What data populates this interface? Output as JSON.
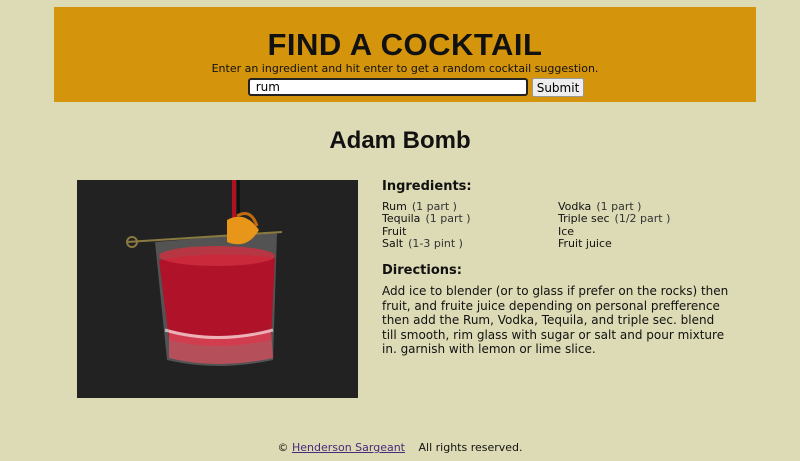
{
  "header": {
    "title": "FIND A COCKTAIL",
    "subtitle": "Enter an ingredient and hit enter to get a random cocktail suggestion.",
    "search_value": "rum",
    "submit_label": "Submit"
  },
  "cocktail": {
    "name": "Adam Bomb",
    "ingredients_title": "Ingredients:",
    "ingredients": [
      {
        "name": "Rum",
        "measure": "(1 part )"
      },
      {
        "name": "Vodka",
        "measure": "(1 part )"
      },
      {
        "name": "Tequila",
        "measure": "(1 part )"
      },
      {
        "name": "Triple sec",
        "measure": "(1/2 part )"
      },
      {
        "name": "Fruit",
        "measure": ""
      },
      {
        "name": "Ice",
        "measure": ""
      },
      {
        "name": "Salt",
        "measure": "(1-3 pint )"
      },
      {
        "name": "Fruit juice",
        "measure": ""
      }
    ],
    "directions_title": "Directions:",
    "directions": "Add ice to blender (or to glass if prefer on the rocks) then fruit, and fruite juice depending on personal prefference then add the Rum, Vodka, Tequila, and triple sec. blend till smooth, rim glass with sugar or salt and pour mixture in. garnish with lemon or lime slice."
  },
  "footer": {
    "copyright_symbol": "©",
    "author_link": "Henderson Sargeant",
    "rights": "All rights reserved."
  }
}
